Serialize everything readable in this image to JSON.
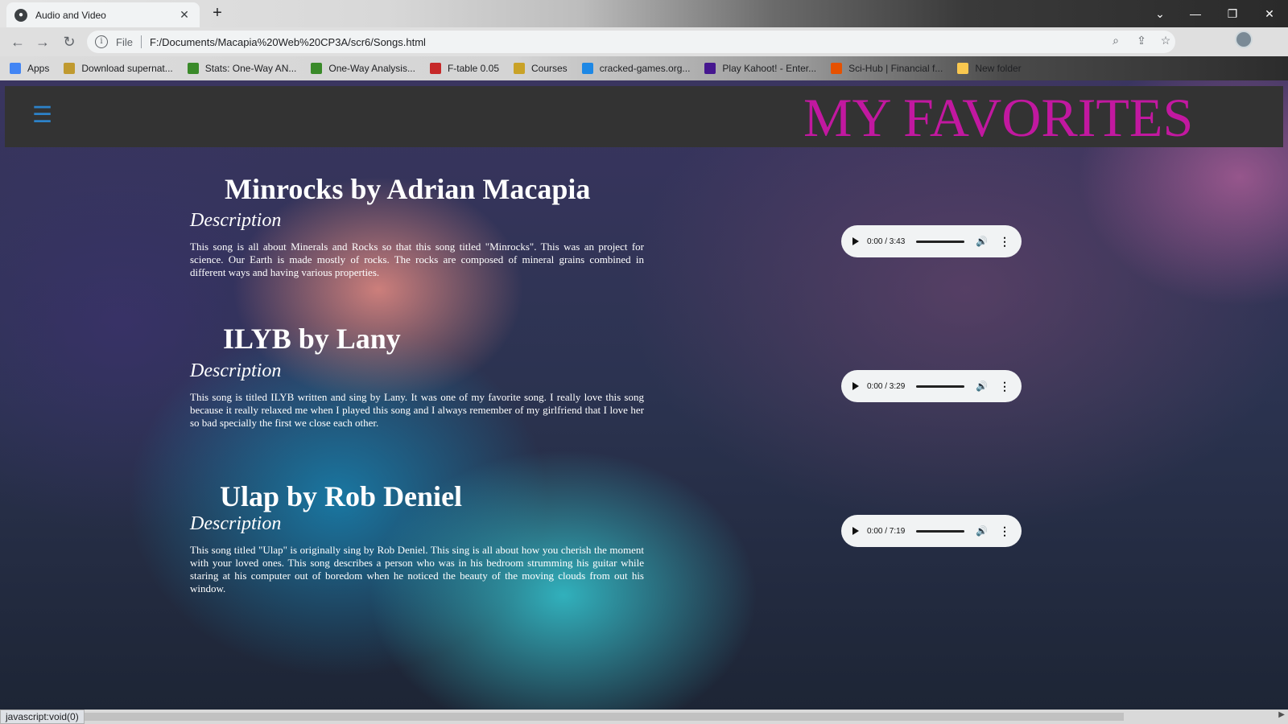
{
  "browser": {
    "tab_title": "Audio and Video",
    "scheme": "File",
    "url": "F:/Documents/Macapia%20Web%20CP3A/scr6/Songs.html",
    "bookmarks": [
      {
        "label": "Apps",
        "icon": "apps-grid-icon",
        "color": "#4285f4"
      },
      {
        "label": "Download supernat...",
        "icon": "download-icon",
        "color": "#c09a30"
      },
      {
        "label": "Stats: One-Way AN...",
        "icon": "leaf-icon",
        "color": "#3a8a2a"
      },
      {
        "label": "One-Way Analysis...",
        "icon": "leaf-icon",
        "color": "#3a8a2a"
      },
      {
        "label": "F-table 0.05",
        "icon": "university-shield-icon",
        "color": "#c62828"
      },
      {
        "label": "Courses",
        "icon": "courses-icon",
        "color": "#c9a227"
      },
      {
        "label": "cracked-games.org...",
        "icon": "download-arrow-icon",
        "color": "#1e88e5"
      },
      {
        "label": "Play Kahoot! - Enter...",
        "icon": "kahoot-icon",
        "color": "#46178f"
      },
      {
        "label": "Sci-Hub | Financial f...",
        "icon": "raven-icon",
        "color": "#e65100"
      },
      {
        "label": "New folder",
        "icon": "folder-icon",
        "color": "#f9c74f"
      }
    ],
    "status_url": "javascript:void(0)"
  },
  "header": {
    "title": "MY FAVORITES",
    "title_color": "#c218a0",
    "menu_icon": "hamburger-menu-icon"
  },
  "songs": [
    {
      "title": "Minrocks by Adrian Macapia",
      "subtitle": "Description",
      "description": "This song is all about Minerals and Rocks so that this song titled \"Minrocks\". This was an project for science. Our Earth is made mostly of rocks. The rocks are composed of mineral grains combined in different ways and having various properties.",
      "player_time": "0:00 / 3:43"
    },
    {
      "title": "ILYB by Lany",
      "subtitle": "Description",
      "description": "This song is titled ILYB written and sing by Lany. It was one of my favorite song. I really love this song because it really relaxed me when I played this song and I always remember of my girlfriend that I love her so bad specially the first we close each other.",
      "player_time": "0:00 / 3:29"
    },
    {
      "title": "Ulap by Rob Deniel",
      "subtitle": "Description",
      "description": "This song titled \"Ulap\" is originally sing by Rob Deniel. This sing is all about how you cherish the moment with your loved ones. This song describes a person who was in his bedroom strumming his guitar while staring at his computer out of boredom when he noticed the beauty of the moving clouds from out his window.",
      "player_time": "0:00 / 7:19"
    }
  ]
}
